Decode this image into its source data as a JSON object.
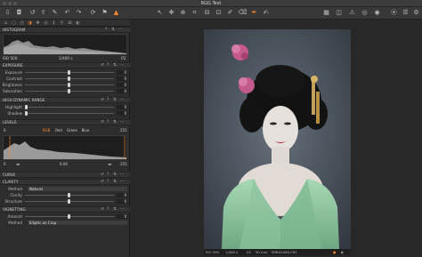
{
  "window": {
    "title": "RGG Test"
  },
  "tabs": [
    "⌂",
    "▢",
    "◷",
    "◑",
    "✚",
    "◎",
    "ℹ",
    "⚲",
    "⊞",
    "◐"
  ],
  "histogram": {
    "title": "HISTOGRAM",
    "iso": "ISO 500",
    "shutter": "1/400 s",
    "ev": "f/2"
  },
  "exposure": {
    "title": "EXPOSURE",
    "rows": [
      {
        "label": "Exposure",
        "value": "0"
      },
      {
        "label": "Contrast",
        "value": "0"
      },
      {
        "label": "Brightness",
        "value": "0"
      },
      {
        "label": "Saturation",
        "value": "0"
      }
    ]
  },
  "hdr": {
    "title": "HIGH DYNAMIC RANGE",
    "rows": [
      {
        "label": "Highlight",
        "value": "0"
      },
      {
        "label": "Shadow",
        "value": "0"
      }
    ]
  },
  "levels": {
    "title": "LEVELS",
    "min_input": "0",
    "max_input": "255",
    "channels": [
      "RGB",
      "Red",
      "Green",
      "Blue"
    ],
    "min_out": "0",
    "mid_out": "0.00",
    "max_out": "255"
  },
  "curve": {
    "title": "CURVE"
  },
  "clarity": {
    "title": "CLARITY",
    "method_label": "Method",
    "method_value": "Natural",
    "rows": [
      {
        "label": "Clarity",
        "value": "0"
      },
      {
        "label": "Structure",
        "value": "0"
      }
    ]
  },
  "vignetting": {
    "title": "VIGNETTING",
    "amount_label": "Amount",
    "amount_value": "0",
    "method_label": "Method",
    "method_value": "Elliptic on Crop"
  },
  "status": {
    "iso": "ISO 500",
    "shutter": "1/400 s",
    "aperture": "f/2",
    "focal": "50 mm",
    "filename": "5RB41408.CR2"
  },
  "colors": {
    "accent": "#ff8a2a",
    "panel": "#2d2d2d",
    "bg": "#282828"
  }
}
